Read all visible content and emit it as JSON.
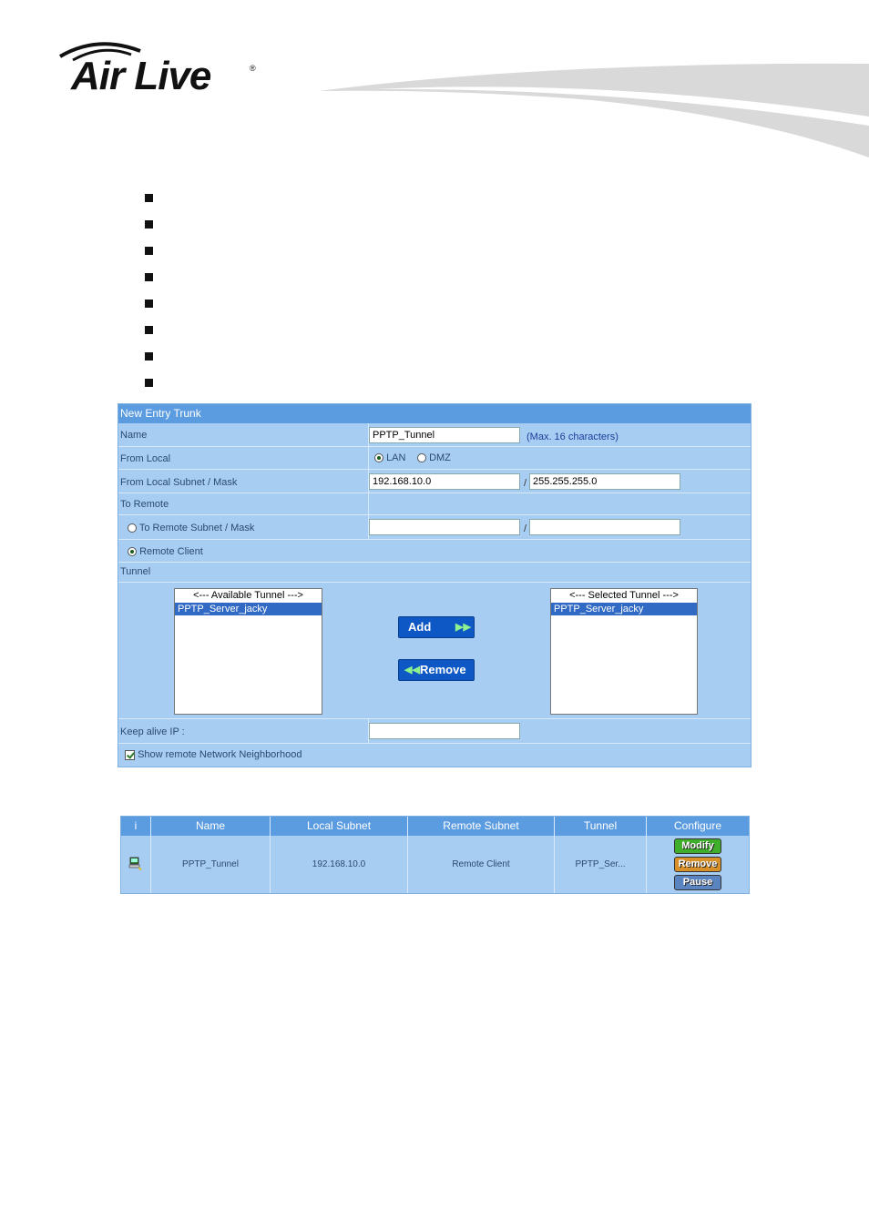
{
  "brand": {
    "logo_text": "Air Live",
    "registered": "®"
  },
  "form": {
    "title": "New Entry Trunk",
    "name_label": "Name",
    "name_value": "PPTP_Tunnel",
    "name_hint": "(Max. 16 characters)",
    "from_local_label": "From Local",
    "lan_label": "LAN",
    "dmz_label": "DMZ",
    "from_local_subnet_label": "From Local Subnet / Mask",
    "local_subnet_value": "192.168.10.0",
    "slash": "/",
    "local_mask_value": "255.255.255.0",
    "to_remote_label": "To Remote",
    "to_remote_subnet_label": "To Remote Subnet / Mask",
    "remote_subnet_value": "",
    "remote_mask_value": "",
    "remote_client_label": "Remote Client",
    "tunnel_label": "Tunnel",
    "available_header": "<--- Available Tunnel --->",
    "available_items": [
      "PPTP_Server_jacky"
    ],
    "selected_header": "<--- Selected Tunnel --->",
    "selected_items": [
      "PPTP_Server_jacky"
    ],
    "add_label": "Add",
    "remove_label": "Remove",
    "keep_alive_label": "Keep alive IP :",
    "keep_alive_value": "",
    "show_neighborhood_label": "Show remote Network Neighborhood"
  },
  "table": {
    "headers": [
      "i",
      "Name",
      "Local Subnet",
      "Remote Subnet",
      "Tunnel",
      "Configure"
    ],
    "row": {
      "name": "PPTP_Tunnel",
      "local_subnet": "192.168.10.0",
      "remote_subnet": "Remote Client",
      "tunnel": "PPTP_Ser..."
    },
    "buttons": {
      "modify": "Modify",
      "remove": "Remove",
      "pause": "Pause"
    }
  },
  "colors": {
    "panel_bg": "#a8cdf3",
    "header_bg": "#5b9be0",
    "button_blue": "#0d58c4",
    "modify": "#3fae2a",
    "remove": "#d8902a",
    "pause": "#5a84c0"
  }
}
